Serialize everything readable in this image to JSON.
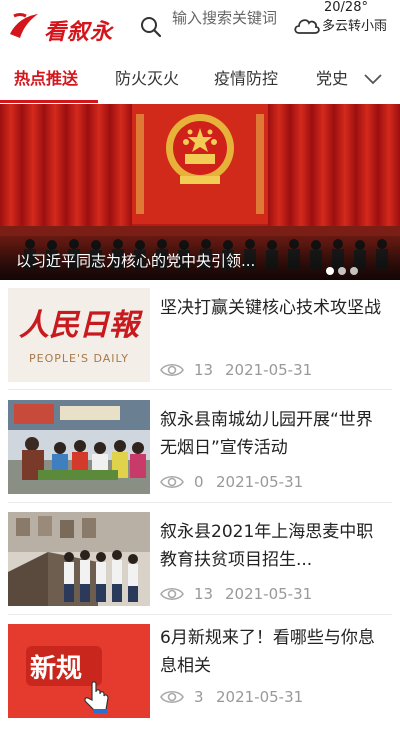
{
  "header": {
    "logo_text": "看叙永",
    "search_placeholder": "输入搜索关键词",
    "weather": {
      "temp": "20/28°",
      "desc": "多云转小雨"
    }
  },
  "tabs": [
    {
      "label": "热点推送",
      "active": true
    },
    {
      "label": "防火灭火",
      "active": false
    },
    {
      "label": "疫情防控",
      "active": false
    },
    {
      "label": "党史",
      "active": false
    }
  ],
  "banner": {
    "title": "以习近平同志为核心的党中央引领...",
    "dots_count": 3,
    "active_dot": 0
  },
  "news": [
    {
      "title": "坚决打赢关键核心技术攻坚战",
      "views": "13",
      "date": "2021-05-31",
      "thumb": {
        "kind": "peoples-daily",
        "logo": "人民日報",
        "en": "PEOPLE'S DAILY"
      }
    },
    {
      "title": "叙永县南城幼儿园开展“世界无烟日”宣传活动",
      "views": "0",
      "date": "2021-05-31",
      "thumb": {
        "kind": "photo-kindergarten"
      }
    },
    {
      "title": "叙永县2021年上海思麦中职教育扶贫项目招生...",
      "views": "13",
      "date": "2021-05-31",
      "thumb": {
        "kind": "photo-stairs"
      }
    },
    {
      "title": "6月新规来了！看哪些与你息息相关",
      "views": "3",
      "date": "2021-05-31",
      "thumb": {
        "kind": "new-rules",
        "text": "新规"
      }
    }
  ],
  "colors": {
    "accent": "#d4161c",
    "meta": "#999999"
  }
}
